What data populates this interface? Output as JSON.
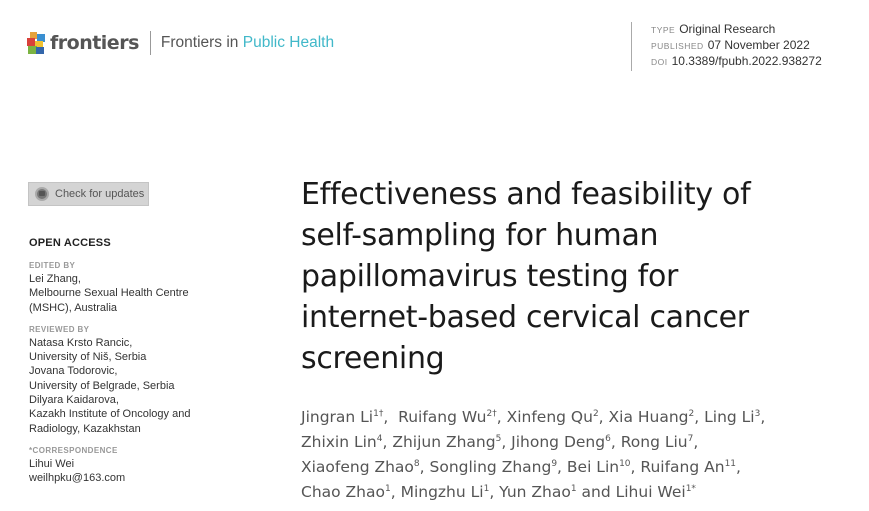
{
  "header": {
    "brand": "frontiers",
    "journal_prefix": "Frontiers in ",
    "journal_name": "Public Health",
    "accent_color": "#41b8c9"
  },
  "meta": {
    "type_label": "TYPE",
    "type_value": "Original Research",
    "published_label": "PUBLISHED",
    "published_value": "07 November 2022",
    "doi_label": "DOI",
    "doi_value": "10.3389/fpubh.2022.938272"
  },
  "check_updates": {
    "label": "Check for updates"
  },
  "sidebar": {
    "open_access": "OPEN ACCESS",
    "edited_by": {
      "label": "EDITED BY",
      "lines": [
        "Lei Zhang,",
        "Melbourne Sexual Health Centre",
        "(MSHC), Australia"
      ]
    },
    "reviewed_by": {
      "label": "REVIEWED BY",
      "lines": [
        "Natasa Krsto Rancic,",
        "University of Niš, Serbia",
        "Jovana Todorovic,",
        "University of Belgrade, Serbia",
        "Dilyara Kaidarova,",
        "Kazakh Institute of Oncology and",
        "Radiology, Kazakhstan"
      ]
    },
    "correspondence": {
      "label": "*CORRESPONDENCE",
      "lines": [
        "Lihui Wei",
        "weilhpku@163.com"
      ]
    }
  },
  "article": {
    "title_lines": [
      "Effectiveness and feasibility of",
      "self-sampling for human",
      "papillomavirus testing for",
      "internet-based cervical cancer",
      "screening"
    ],
    "author_lines": [
      [
        {
          "name": "Jingran Li",
          "sup": "1†",
          "sep": ",  "
        },
        {
          "name": "Ruifang Wu",
          "sup": "2†",
          "sep": ", "
        },
        {
          "name": "Xinfeng Qu",
          "sup": "2",
          "sep": ", "
        },
        {
          "name": "Xia Huang",
          "sup": "2",
          "sep": ", "
        },
        {
          "name": "Ling Li",
          "sup": "3",
          "sep": ","
        }
      ],
      [
        {
          "name": "Zhixin Lin",
          "sup": "4",
          "sep": ", "
        },
        {
          "name": "Zhijun Zhang",
          "sup": "5",
          "sep": ", "
        },
        {
          "name": "Jihong Deng",
          "sup": "6",
          "sep": ", "
        },
        {
          "name": "Rong Liu",
          "sup": "7",
          "sep": ","
        }
      ],
      [
        {
          "name": "Xiaofeng Zhao",
          "sup": "8",
          "sep": ", "
        },
        {
          "name": "Songling Zhang",
          "sup": "9",
          "sep": ", "
        },
        {
          "name": "Bei Lin",
          "sup": "10",
          "sep": ", "
        },
        {
          "name": "Ruifang An",
          "sup": "11",
          "sep": ","
        }
      ],
      [
        {
          "name": "Chao Zhao",
          "sup": "1",
          "sep": ", "
        },
        {
          "name": "Mingzhu Li",
          "sup": "1",
          "sep": ", "
        },
        {
          "name": "Yun Zhao",
          "sup": "1",
          "sep": " and "
        },
        {
          "name": "Lihui Wei",
          "sup": "1*",
          "sep": ""
        }
      ]
    ]
  }
}
